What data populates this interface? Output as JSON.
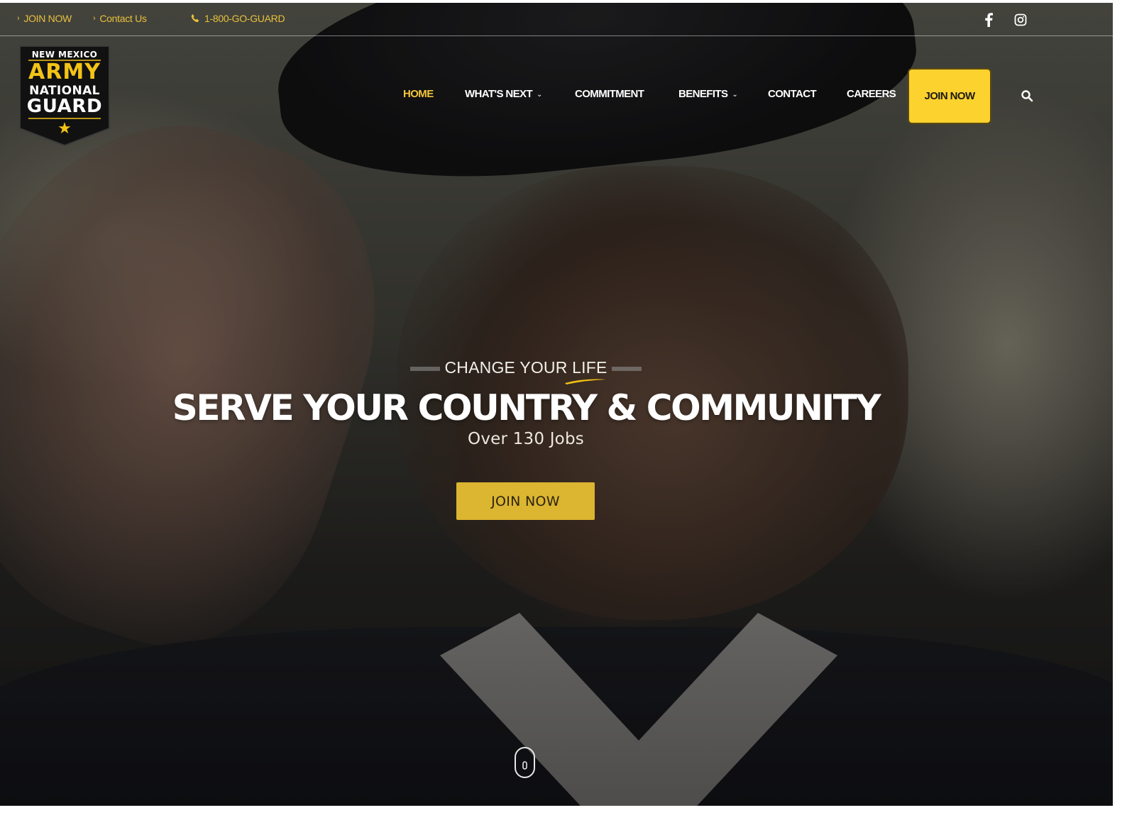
{
  "topbar": {
    "join_label": "JOIN NOW",
    "contact_label": "Contact Us",
    "phone_label": "1-800-GO-GUARD",
    "social": [
      "facebook-icon",
      "instagram-icon"
    ]
  },
  "logo": {
    "line1": "NEW MEXICO",
    "line2": "ARMY",
    "line3": "NATIONAL",
    "line4": "GUARD"
  },
  "nav": {
    "items": [
      {
        "label": "HOME",
        "active": true
      },
      {
        "label": "WHAT'S NEXT",
        "dropdown": true
      },
      {
        "label": "COMMITMENT"
      },
      {
        "label": "BENEFITS",
        "dropdown": true
      },
      {
        "label": "CONTACT"
      },
      {
        "label": "CAREERS"
      }
    ],
    "join_label": "JOIN NOW"
  },
  "hero": {
    "eyebrow": "CHANGE YOUR LIFE",
    "headline": "SERVE YOUR COUNTRY & COMMUNITY",
    "subheadline": "Over 130 Jobs",
    "cta_label": "JOIN NOW"
  },
  "colors": {
    "accent": "#fcd22e",
    "accent_text": "#e8c13a",
    "cta": "#dcb531",
    "logo_bg": "#111111"
  }
}
